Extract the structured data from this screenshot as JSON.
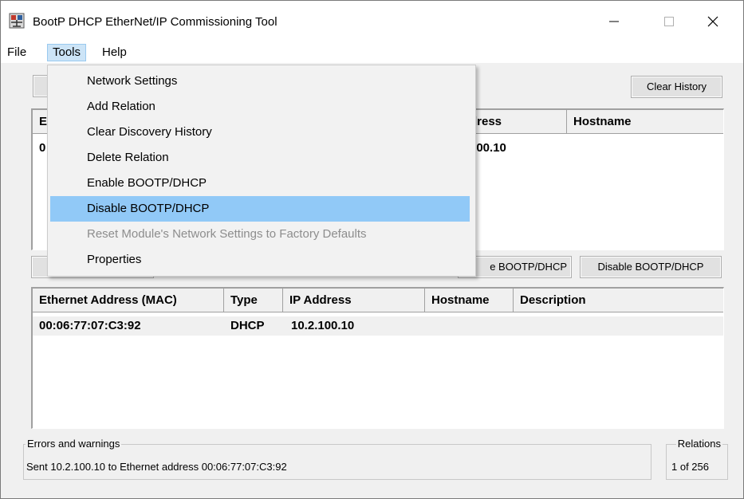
{
  "window": {
    "title": "BootP DHCP EtherNet/IP Commissioning Tool",
    "controls": {
      "minimize": "—",
      "maximize": "☐",
      "close": "✕"
    }
  },
  "menubar": {
    "file": "File",
    "tools": "Tools",
    "help": "Help"
  },
  "tools_menu": {
    "items": [
      {
        "label": "Network Settings",
        "enabled": true
      },
      {
        "label": "Add Relation",
        "enabled": true
      },
      {
        "label": "Clear Discovery History",
        "enabled": true
      },
      {
        "label": "Delete Relation",
        "enabled": true
      },
      {
        "label": "Enable BOOTP/DHCP",
        "enabled": true
      },
      {
        "label": "Disable BOOTP/DHCP",
        "enabled": true,
        "highlighted": true
      },
      {
        "label": "Reset Module's Network Settings to Factory Defaults",
        "enabled": false
      },
      {
        "label": "Properties",
        "enabled": true
      }
    ]
  },
  "discovery": {
    "clear_history_button": "Clear History",
    "columns_visible": {
      "first": "E",
      "address": "dress",
      "hostname": "Hostname"
    },
    "row_visible": {
      "first": "0",
      "address": "100.10"
    }
  },
  "relation_buttons": {
    "enable_partial": "e BOOTP/DHCP",
    "disable": "Disable BOOTP/DHCP"
  },
  "relations_table": {
    "columns": [
      "Ethernet Address (MAC)",
      "Type",
      "IP Address",
      "Hostname",
      "Description"
    ],
    "rows": [
      {
        "mac": "00:06:77:07:C3:92",
        "type": "DHCP",
        "ip": "10.2.100.10",
        "hostname": "",
        "description": ""
      }
    ]
  },
  "status": {
    "errors_label": "Errors and warnings",
    "errors_text": "Sent 10.2.100.10 to Ethernet address 00:06:77:07:C3:92",
    "relations_label": "Relations",
    "relations_text": "1 of 256"
  },
  "colors": {
    "menu_highlight": "#91c9f7",
    "menu_open_bg": "#cce4f7",
    "disabled_text": "#8d8d8d",
    "window_bg": "#f0f0f0"
  }
}
